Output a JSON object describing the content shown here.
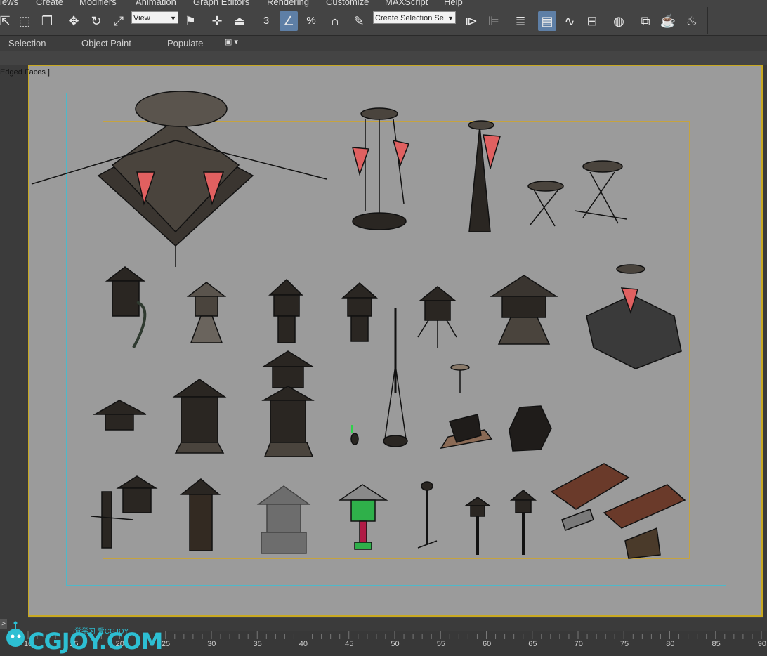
{
  "menu": {
    "items": [
      "iews",
      "Create",
      "Modifiers",
      "Animation",
      "Graph Editors",
      "Rendering",
      "Customize",
      "MAXScript",
      "Help"
    ]
  },
  "toolbar": {
    "ref_coord": "View",
    "selection_set": "Create Selection Se",
    "snap_3": "3",
    "percent_snap": "%"
  },
  "ribbon": {
    "tabs": [
      "Selection",
      "Object Paint",
      "Populate"
    ]
  },
  "viewport": {
    "label": "Edged Faces ]",
    "colors": {
      "background": "#9b9b9b",
      "border": "#c8a922",
      "safe_action": "#4fb8c9",
      "safe_title": "#c5a340"
    }
  },
  "timeline": {
    "ticks": [
      "10",
      "15",
      "20",
      "25",
      "30",
      "35",
      "40",
      "45",
      "50",
      "55",
      "60",
      "65",
      "70",
      "75",
      "80",
      "85",
      "90"
    ]
  },
  "watermark": {
    "logo": "CGJOY.COM",
    "subtitle": "觉学习 爱CGJOY"
  },
  "icons": [
    "select-arrow-icon",
    "rect-select-icon",
    "window-crossing-icon",
    "move-icon",
    "rotate-icon",
    "scale-icon",
    "select-manipulate-icon",
    "pivot-icon",
    "snap-3d-icon",
    "angle-snap-icon",
    "percent-snap-icon",
    "spinner-snap-icon",
    "edit-named-selection-icon",
    "mirror-icon",
    "align-icon",
    "layer-manager-icon",
    "scene-explorer-icon",
    "curve-editor-icon",
    "schematic-view-icon",
    "material-editor-icon",
    "render-setup-icon",
    "rendered-frame-icon",
    "render-teapot-icon"
  ]
}
